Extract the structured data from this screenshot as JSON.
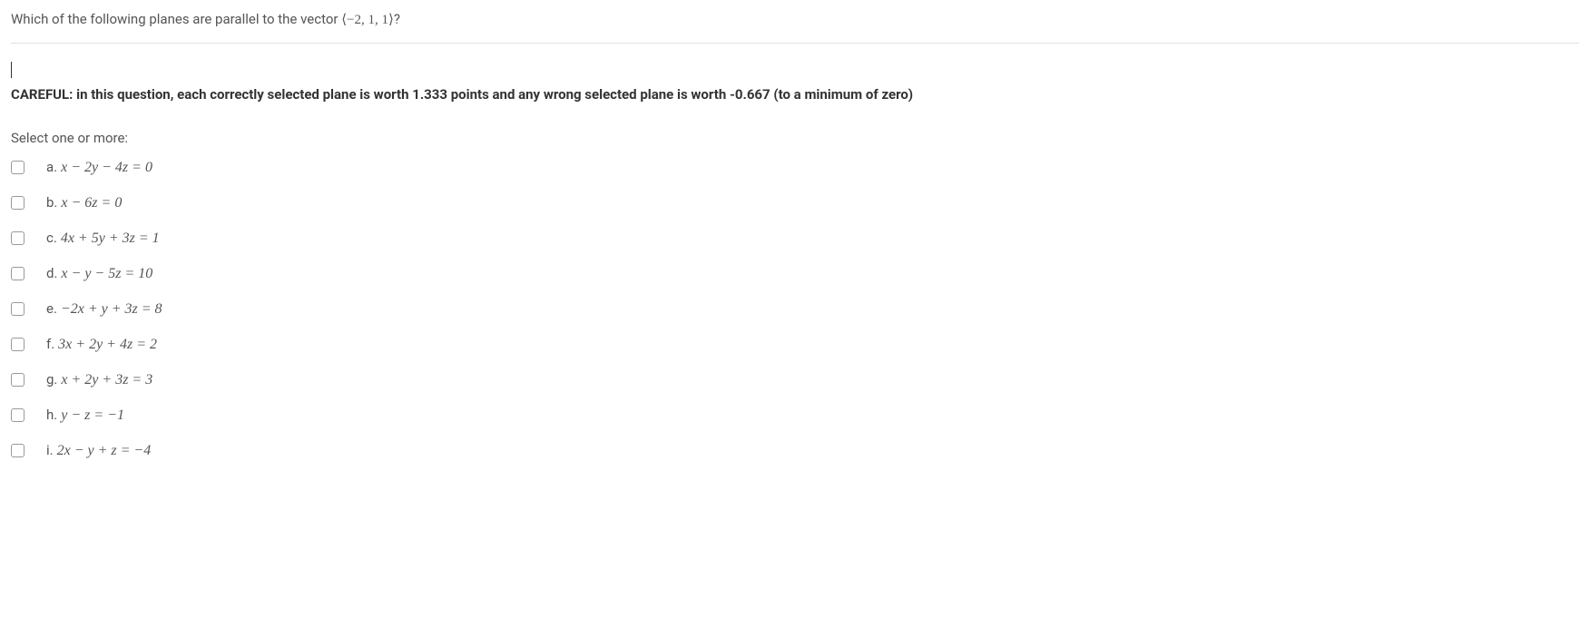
{
  "question": {
    "prefix": "Which of the following planes are parallel to the vector ",
    "vector": "⟨−2, 1, 1⟩",
    "suffix": "?"
  },
  "careful_note": "CAREFUL: in this question, each correctly selected plane is worth 1.333 points and any wrong selected plane is worth -0.667 (to a minimum of zero)",
  "select_prompt": "Select one or more:",
  "options": [
    {
      "letter": "a.",
      "equation": "x − 2y − 4z = 0"
    },
    {
      "letter": "b.",
      "equation": "x − 6z = 0"
    },
    {
      "letter": "c.",
      "equation": "4x + 5y + 3z = 1"
    },
    {
      "letter": "d.",
      "equation": "x − y − 5z = 10"
    },
    {
      "letter": "e.",
      "equation": "−2x + y + 3z = 8"
    },
    {
      "letter": "f.",
      "equation": "3x + 2y + 4z = 2"
    },
    {
      "letter": "g.",
      "equation": "x + 2y + 3z = 3"
    },
    {
      "letter": "h.",
      "equation": "y − z = −1"
    },
    {
      "letter": "i.",
      "equation": "2x − y + z = −4"
    }
  ]
}
